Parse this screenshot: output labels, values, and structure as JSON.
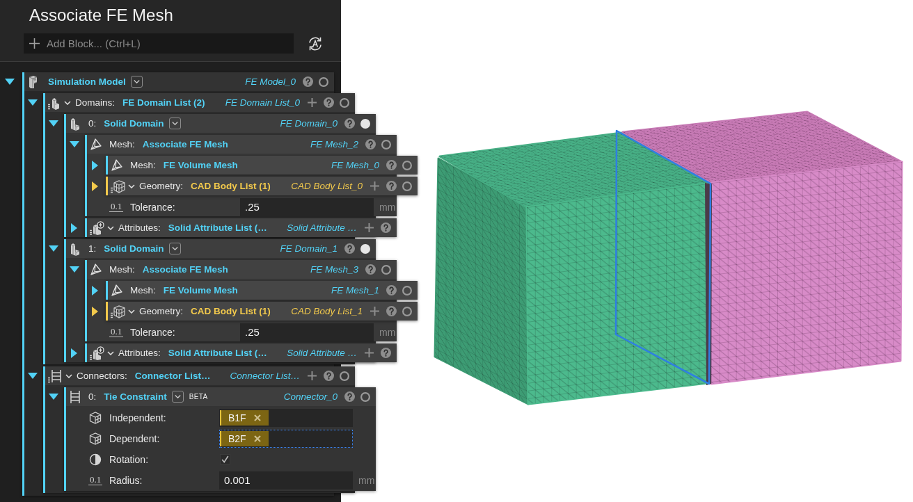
{
  "panel": {
    "title": "Associate FE Mesh",
    "add_block": {
      "placeholder": "Add Block... (Ctrl+L)"
    },
    "tree": [
      {
        "kind": "model",
        "color": "#52d2f6",
        "expanded": true,
        "value": "Simulation Model",
        "name": "FE Model_0",
        "visible": false,
        "children": [
          {
            "kind": "domains",
            "color": "#52d2f6",
            "expanded": true,
            "label": "Domains:",
            "value": "FE Domain List (2)",
            "name": "FE Domain List_0",
            "visible": false,
            "children": [
              {
                "kind": "domain",
                "color": "#52d2f6",
                "expanded": true,
                "label": "0:",
                "value": "Solid Domain",
                "name": "FE Domain_0",
                "visible": true,
                "children": [
                  {
                    "kind": "mesh",
                    "color": "#52d2f6",
                    "expanded": true,
                    "label": "Mesh:",
                    "value": "Associate FE Mesh",
                    "name": "FE Mesh_2",
                    "visible": false,
                    "children": [
                      {
                        "kind": "mesh",
                        "color": "#52d2f6",
                        "expanded": false,
                        "label": "Mesh:",
                        "value": "FE Volume Mesh",
                        "name": "FE Mesh_0",
                        "visible": false
                      },
                      {
                        "kind": "geometry",
                        "color": "#f2c94c",
                        "expanded": false,
                        "label": "Geometry:",
                        "value": "CAD Body List (1)",
                        "name": "CAD Body List_0",
                        "visible": false
                      },
                      {
                        "kind": "number",
                        "glyph": "0.1",
                        "label": "Tolerance:",
                        "value": ".25",
                        "unit": "mm"
                      }
                    ]
                  },
                  {
                    "kind": "attributes",
                    "color": "#52d2f6",
                    "expanded": false,
                    "label": "Attributes:",
                    "value": "Solid Attribute List (…",
                    "name": "Solid Attribute …"
                  }
                ]
              },
              {
                "kind": "domain",
                "color": "#52d2f6",
                "expanded": true,
                "label": "1:",
                "value": "Solid Domain",
                "name": "FE Domain_1",
                "visible": true,
                "children": [
                  {
                    "kind": "mesh",
                    "color": "#52d2f6",
                    "expanded": true,
                    "label": "Mesh:",
                    "value": "Associate FE Mesh",
                    "name": "FE Mesh_3",
                    "visible": false,
                    "children": [
                      {
                        "kind": "mesh",
                        "color": "#52d2f6",
                        "expanded": false,
                        "label": "Mesh:",
                        "value": "FE Volume Mesh",
                        "name": "FE Mesh_1",
                        "visible": false
                      },
                      {
                        "kind": "geometry",
                        "color": "#f2c94c",
                        "expanded": false,
                        "label": "Geometry:",
                        "value": "CAD Body List (1)",
                        "name": "CAD Body List_1",
                        "visible": false
                      },
                      {
                        "kind": "number",
                        "glyph": "0.1",
                        "label": "Tolerance:",
                        "value": ".25",
                        "unit": "mm"
                      }
                    ]
                  },
                  {
                    "kind": "attributes",
                    "color": "#52d2f6",
                    "expanded": false,
                    "label": "Attributes:",
                    "value": "Solid Attribute List (…",
                    "name": "Solid Attribute …"
                  }
                ]
              }
            ]
          },
          {
            "kind": "connectors",
            "color": "#52d2f6",
            "expanded": true,
            "label": "Connectors:",
            "value": "Connector List…",
            "name": "Connector List…",
            "visible": false,
            "children": [
              {
                "kind": "connector",
                "color": "#52d2f6",
                "expanded": true,
                "label": "0:",
                "value": "Tie Constraint",
                "badge": "BETA",
                "name": "Connector_0",
                "visible": false,
                "children": [
                  {
                    "kind": "selection",
                    "label": "Independent:",
                    "focused": false,
                    "tokens": [
                      {
                        "label": "B1F"
                      }
                    ]
                  },
                  {
                    "kind": "selection",
                    "label": "Dependent:",
                    "focused": true,
                    "tokens": [
                      {
                        "label": "B2F"
                      }
                    ]
                  },
                  {
                    "kind": "toggle",
                    "label": "Rotation:",
                    "checked": true
                  },
                  {
                    "kind": "number",
                    "glyph": "0.1",
                    "label": "Radius:",
                    "value": "0.001",
                    "unit": "mm"
                  }
                ]
              }
            ]
          }
        ]
      }
    ]
  }
}
